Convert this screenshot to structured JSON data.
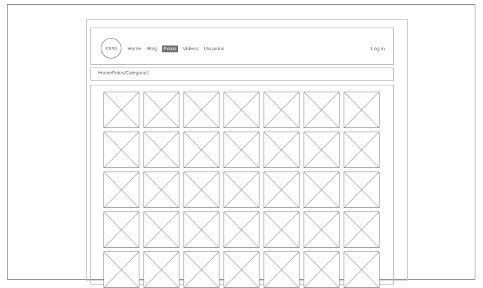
{
  "header": {
    "logo_label": "icono",
    "nav": [
      {
        "label": "Home",
        "active": false
      },
      {
        "label": "Blog",
        "active": false
      },
      {
        "label": "Fotos",
        "active": true
      },
      {
        "label": "Videos",
        "active": false
      },
      {
        "label": "Usuarios",
        "active": false
      }
    ],
    "login_label": "Log in"
  },
  "breadcrumb": "Home/Fotos/Categoria1",
  "gallery": {
    "columns": 7,
    "rows": 5,
    "placeholder_icon": "image-placeholder-icon"
  }
}
